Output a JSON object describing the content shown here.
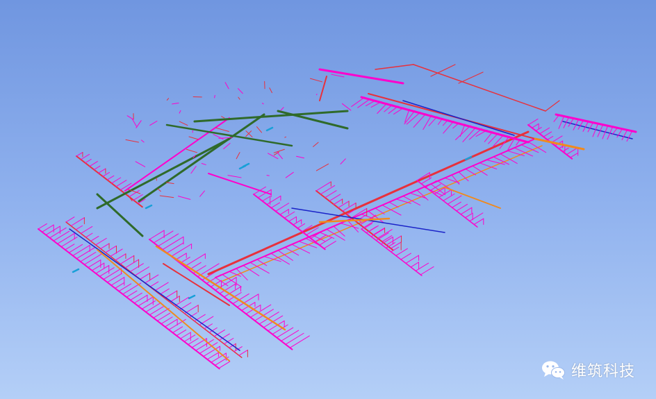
{
  "watermark": {
    "text": "维筑科技",
    "icon": "wechat-icon"
  },
  "colors": {
    "background_top": "#7096e0",
    "background_bottom": "#b4cff7",
    "sanitary_pipe": "#ff00cc",
    "drainage_pipe": "#e8303c",
    "hot_water_pipe": "#f08a1e",
    "supply_pipe": "#1a22c8",
    "gas_pipe": "#2f6a2a",
    "fitting": "#18a0d8"
  }
}
